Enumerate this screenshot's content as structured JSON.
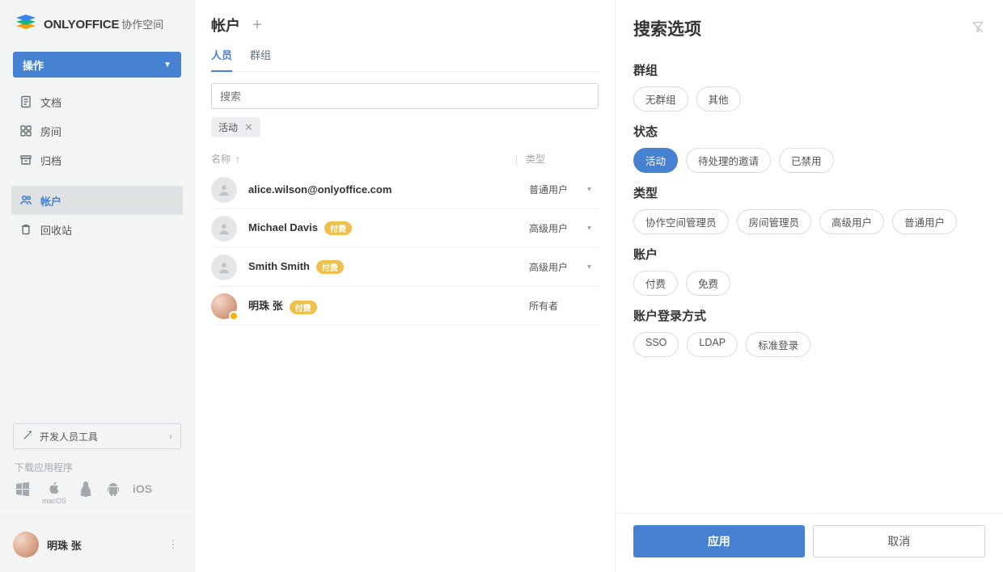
{
  "brand": {
    "name": "ONLYOFFICE",
    "subtitle": "协作空间"
  },
  "sidebar": {
    "operations_label": "操作",
    "nav": {
      "docs": "文档",
      "rooms": "房间",
      "archive": "归档",
      "accounts": "帐户",
      "trash": "回收站"
    },
    "dev_tools": "开发人员工具",
    "download_apps_label": "下载应用程序",
    "apps": {
      "mac_label": "macOS",
      "ios_label": "iOS"
    }
  },
  "user": {
    "name": "明珠 张"
  },
  "page": {
    "title": "帐户",
    "tabs": {
      "people": "人员",
      "groups": "群组"
    },
    "search_placeholder": "搜索",
    "active_chip": "活动",
    "columns": {
      "name": "名称",
      "type": "类型"
    },
    "rows": [
      {
        "name": "alice.wilson@onlyoffice.com",
        "type": "普通用户",
        "badge": "",
        "photo": false,
        "caret": true
      },
      {
        "name": "Michael Davis",
        "type": "高级用户",
        "badge": "付费",
        "photo": false,
        "caret": true
      },
      {
        "name": "Smith Smith",
        "type": "高级用户",
        "badge": "付费",
        "photo": false,
        "caret": true
      },
      {
        "name": "明珠 张",
        "type": "所有者",
        "badge": "付费",
        "photo": true,
        "caret": false
      }
    ]
  },
  "panel": {
    "title": "搜索选项",
    "sections": {
      "group": {
        "title": "群组",
        "options": [
          "无群组",
          "其他"
        ],
        "active": null
      },
      "status": {
        "title": "状态",
        "options": [
          "活动",
          "待处理的邀请",
          "已禁用"
        ],
        "active": "活动"
      },
      "type": {
        "title": "类型",
        "options": [
          "协作空间管理员",
          "房间管理员",
          "高级用户",
          "普通用户"
        ],
        "active": null
      },
      "account": {
        "title": "账户",
        "options": [
          "付费",
          "免费"
        ],
        "active": null
      },
      "login": {
        "title": "账户登录方式",
        "options": [
          "SSO",
          "LDAP",
          "标准登录"
        ],
        "active": null
      }
    },
    "apply": "应用",
    "cancel": "取消"
  }
}
